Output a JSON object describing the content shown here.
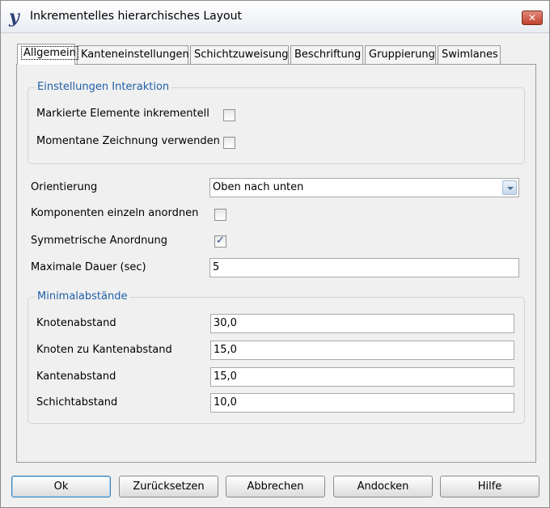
{
  "window": {
    "title": "Inkrementelles hierarchisches Layout",
    "app_icon_glyph": "y",
    "close_glyph": "✕"
  },
  "tabs": [
    {
      "label": "Allgemein",
      "active": true
    },
    {
      "label": "Kanteneinstellungen",
      "active": false
    },
    {
      "label": "Schichtzuweisung",
      "active": false
    },
    {
      "label": "Beschriftung",
      "active": false
    },
    {
      "label": "Gruppierung",
      "active": false
    },
    {
      "label": "Swimlanes",
      "active": false
    }
  ],
  "interaction_group": {
    "title": "Einstellungen Interaktion",
    "incremental_label": "Markierte Elemente inkrementell",
    "incremental_checked": false,
    "use_current_drawing_label": "Momentane Zeichnung verwenden",
    "use_current_drawing_checked": false
  },
  "general": {
    "orientation_label": "Orientierung",
    "orientation_value": "Oben nach unten",
    "components_label": "Komponenten einzeln anordnen",
    "components_checked": false,
    "symmetric_label": "Symmetrische Anordnung",
    "symmetric_checked": true,
    "max_duration_label": "Maximale Dauer (sec)",
    "max_duration_value": "5"
  },
  "distances_group": {
    "title": "Minimalabstände",
    "node_distance_label": "Knotenabstand",
    "node_distance_value": "30,0",
    "node_edge_distance_label": "Knoten zu Kantenabstand",
    "node_edge_distance_value": "15,0",
    "edge_distance_label": "Kantenabstand",
    "edge_distance_value": "15,0",
    "layer_distance_label": "Schichtabstand",
    "layer_distance_value": "10,0"
  },
  "buttons": {
    "ok": "Ok",
    "reset": "Zurücksetzen",
    "cancel": "Abbrechen",
    "dock": "Andocken",
    "help": "Hilfe"
  },
  "colors": {
    "group_title": "#1f5fa8",
    "close_button": "#c2412d"
  }
}
